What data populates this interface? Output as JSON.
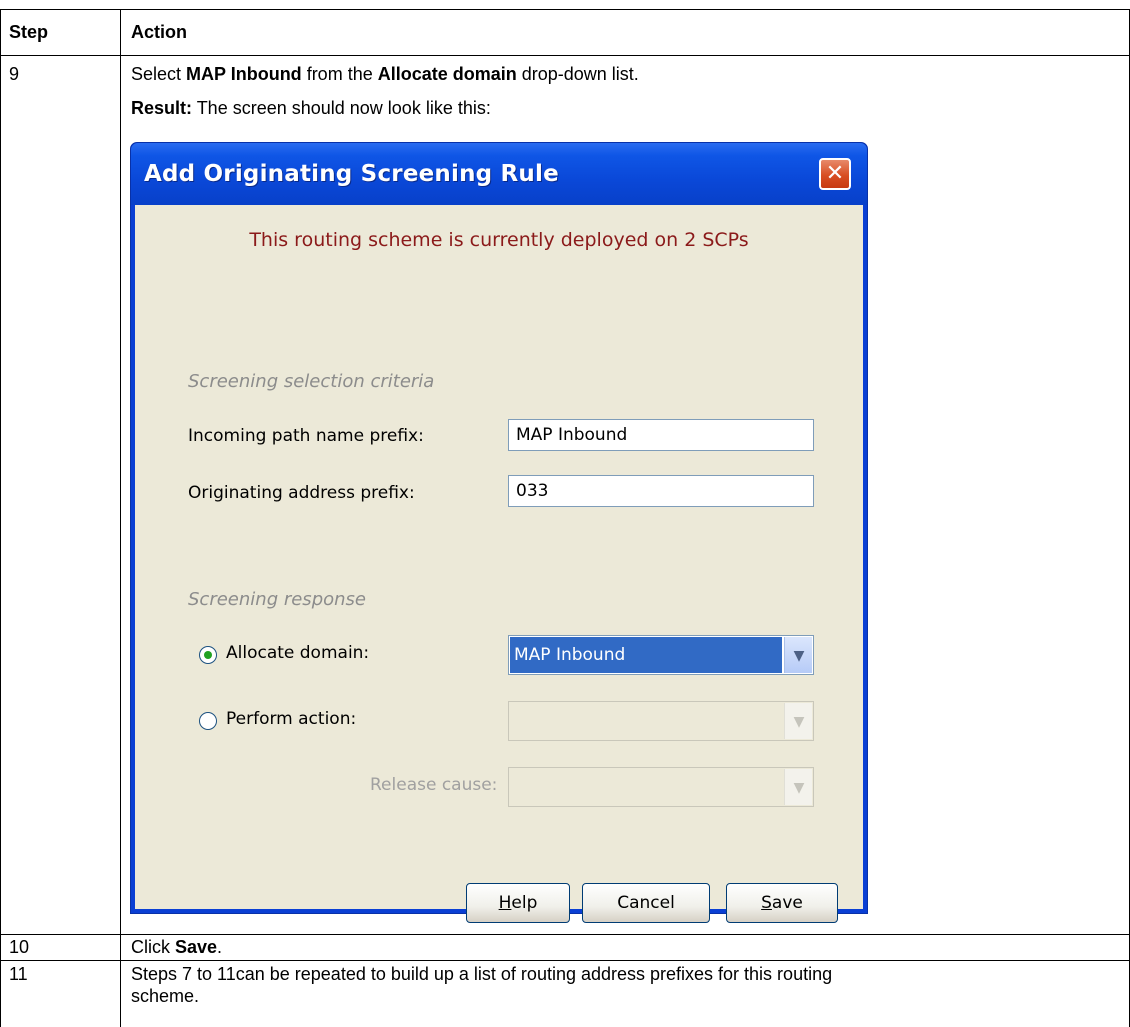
{
  "table": {
    "header": {
      "step": "Step",
      "action": "Action"
    },
    "rows": [
      {
        "step": "9",
        "line1": {
          "pre": "Select ",
          "bold1": "MAP Inbound",
          "mid": " from the ",
          "bold2": "Allocate domain",
          "post": " drop-down list."
        },
        "line2": {
          "bold": "Result:",
          "rest": " The screen should now look like this:"
        }
      },
      {
        "step": "10",
        "pre": "Click ",
        "bold": "Save",
        "post": "."
      },
      {
        "step": "11",
        "line1": "Steps 7 to 11can be repeated to build up a list of routing address prefixes for this routing",
        "line2": "scheme."
      }
    ]
  },
  "dialog": {
    "title": "Add Originating Screening Rule",
    "close_glyph": "✕",
    "deployment_message": "This routing scheme is currently deployed on 2 SCPs",
    "selection_section": "Screening selection criteria",
    "incoming_path_label": "Incoming path name prefix:",
    "incoming_path_value": "MAP Inbound",
    "originating_address_label": "Originating address prefix:",
    "originating_address_value": "033",
    "response_section": "Screening response",
    "allocate_domain_label": "Allocate domain:",
    "allocate_domain_value": "MAP Inbound",
    "allocate_domain_selected": true,
    "perform_action_label": "Perform action:",
    "perform_action_value": "",
    "release_cause_label": "Release cause:",
    "release_cause_value": "",
    "buttons": {
      "help": {
        "mnemonic": "H",
        "rest": "elp"
      },
      "cancel": "Cancel",
      "save": {
        "mnemonic": "S",
        "rest": "ave"
      }
    },
    "dropdown_glyph": "▼"
  },
  "colors": {
    "titlebar": "#0a48d8",
    "dialog_face": "#ece9d8",
    "deploy_message": "#8b1a1a",
    "section_label": "#8c8c8c",
    "selected_value_bg": "#316ac5"
  }
}
